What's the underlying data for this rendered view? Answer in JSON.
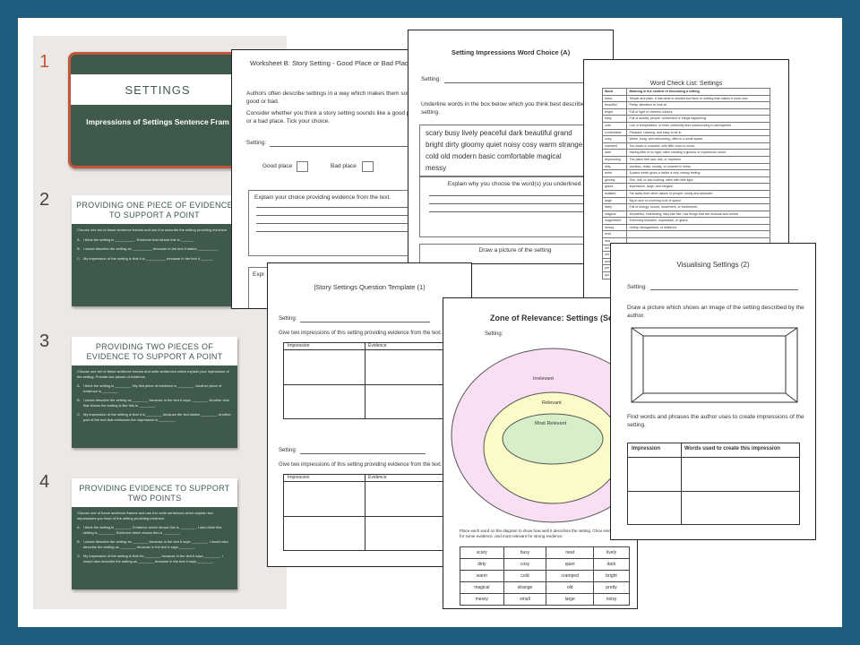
{
  "strip": {
    "numbers": [
      "1",
      "2",
      "3",
      "4"
    ],
    "slide1": {
      "title": "SETTINGS",
      "subtitle": "Impressions of Settings  Sentence Fram"
    },
    "slide2": {
      "title": "PROVIDING ONE PIECE OF EVIDENCE TO SUPPORT A POINT",
      "intro": "Choose one set of these sentence frames and use it to describe the setting providing evidence.",
      "items": [
        {
          "letter": "A.",
          "text": "I think the setting is __________. Evidence that shows this is ______."
        },
        {
          "letter": "B.",
          "text": "I would describe the setting as __________ because in the text it states __________."
        },
        {
          "letter": "C.",
          "text": "My impression of the setting is that it is __________ because in the text it ______."
        }
      ]
    },
    "slide3": {
      "title": "PROVIDING TWO PIECES OF EVIDENCE TO SUPPORT A POINT",
      "intro": "Choose one set of these sentence frames and write sentences which explain your impression of the setting. Provide two pieces of evidence.",
      "items": [
        {
          "letter": "A.",
          "text": "I think the setting is ________. My first piece of evidence is ________. Another piece of evidence is ________."
        },
        {
          "letter": "B.",
          "text": "I would describe the setting as ________ because in the text it says ________. Another clue that shows the setting is like this is ________."
        },
        {
          "letter": "C.",
          "text": "My impression of the setting is that it is ________ because the text states ________. Another part of the text that reinforces the impression is ________."
        }
      ]
    },
    "slide4": {
      "title": "PROVIDING EVIDENCE TO SUPPORT TWO POINTS",
      "intro": "Choose one of these sentence frames and use it to write sentences which explain two impressions you have of the setting providing evidence.",
      "items": [
        {
          "letter": "A.",
          "text": "I think the setting is ________. Evidence which shows this is ________. I also think this setting is ________. Evidence which shows this is ________."
        },
        {
          "letter": "B.",
          "text": "I would describe the setting as ________ because in the text it says ________. I would also describe the setting as ________ because in the text it says ________."
        },
        {
          "letter": "C.",
          "text": "My impression of the setting is that it's ________ because in the text it says ________. I would also describe the setting as ________ because in the text it says ________."
        }
      ]
    }
  },
  "ws_b": {
    "title": "Worksheet B: Story Setting - Good Place or Bad Place?",
    "p1": "Authors often describe settings in a way which makes them sound good or bad.",
    "p2": "Consider whether you think a story setting sounds like a good place or a bad place. Tick your choice.",
    "setting": "Setting:",
    "good": "Good place",
    "bad": "Bad place",
    "explain": "Explain your choice providing evidence from the text.",
    "explain2": "Expl"
  },
  "ws_wc": {
    "title": "Setting Impressions Word Choice (A)",
    "setting": "Setting:",
    "instruction": "Underline words in the box below which you think best describe the setting.",
    "words": [
      "scary busy  lively  peaceful  dark  beautiful  grand",
      "bright  dirty  gloomy quiet  noisy  cosy warm  strange",
      "cold old modern  basic  comfortable  magical  messy"
    ],
    "explain": "Explain why you choose the word(s) you underlined.",
    "draw": "Draw a picture of the setting"
  },
  "ws_cl": {
    "title": "Word Check List: Settings",
    "header": [
      "Word",
      "Meaning in the context of describing a setting"
    ],
    "rows": [
      [
        "basic",
        "Simple and plain. It has what is needed but there is nothing that makes it more nice."
      ],
      [
        "beautiful",
        "Pretty, attractive to look at."
      ],
      [
        "bright",
        "Full of light or cheerful colours."
      ],
      [
        "busy",
        "Full of activity, people, movement or things happening."
      ],
      [
        "cold",
        "Low in temperature, or feels unfriendly and unwelcoming in atmosphere."
      ],
      [
        "comfortable",
        "Pleasant, relaxing, and easy to be in."
      ],
      [
        "cosy",
        "Warm, snug, and welcoming, often in a small space."
      ],
      [
        "cramped",
        "Too small or crowded, with little room to move."
      ],
      [
        "dark",
        "Having little or no light; often creating a gloomy or mysterious mood."
      ],
      [
        "depressing",
        "The place feel sad, dull, or hopeless."
      ],
      [
        "dirty",
        "Unclean, dusty, muddy, or covered in mess."
      ],
      [
        "eerie",
        "A place which gives a visitor a very creepy feeling."
      ],
      [
        "gloomy",
        "Dim, dull, or sad-looking; often with little light."
      ],
      [
        "grand",
        "Impressive, large, and elegant."
      ],
      [
        "isolated",
        "Far away from other places or people; lonely and separate."
      ],
      [
        "large",
        "Big in size or covering a lot of space."
      ],
      [
        "lively",
        "Full of energy, sound, movement, or excitement."
      ],
      [
        "magical",
        "Wonderful, enchanting, fairy-tale like, has things that are unusual and unreal."
      ],
      [
        "magnificent",
        "Extremely beautiful, impressive, or grand."
      ],
      [
        "messy",
        "Untidy, disorganised, or cluttered."
      ],
      [
        "mod",
        ""
      ],
      [
        "nea",
        ""
      ],
      [
        "noi",
        ""
      ],
      [
        "old",
        ""
      ],
      [
        "pea",
        ""
      ],
      [
        "pre",
        ""
      ],
      [
        "qui",
        ""
      ]
    ]
  },
  "ws_q": {
    "title": "|Story Settings Question Template (1)",
    "setting": "Setting:",
    "instruction": "Give two  impressions of this setting providing evidence from the text.",
    "col1": "Impression",
    "col2": "Evidence"
  },
  "ws_z": {
    "title": "Zone of Relevance: Settings (Set A",
    "setting": "Setting:",
    "irrelevant": "Irrelevant",
    "relevant": "Relevant",
    "most": "Most Relevant",
    "instruction": "Place each word on the diagram to show how well it describes the setting. Choo evidence, relevant for some evidence, and most relevant for strong evidence.",
    "grid": [
      [
        "scary",
        "busy",
        "neat",
        "lively"
      ],
      [
        "dirty",
        "cosy",
        "quiet",
        "dark"
      ],
      [
        "warm",
        "cold",
        "cramped",
        "bright"
      ],
      [
        "magical",
        "strange",
        "old",
        "pretty"
      ],
      [
        "messy",
        "small",
        "large",
        "noisy"
      ]
    ]
  },
  "ws_v": {
    "title": "Visualising Settings (2)",
    "setting": "Setting:",
    "instruction": "Draw a picture which shows an image of the setting described by the author.",
    "find": "Find words and phrases the author uses to create impressions of the setting.",
    "col1": "Impression",
    "col2": "Words used to create this impression"
  },
  "colors": {
    "frame": "#1f5c7e",
    "slide": "#3f5a4b",
    "selected": "#c0563a",
    "strip": "#ece8e6"
  }
}
